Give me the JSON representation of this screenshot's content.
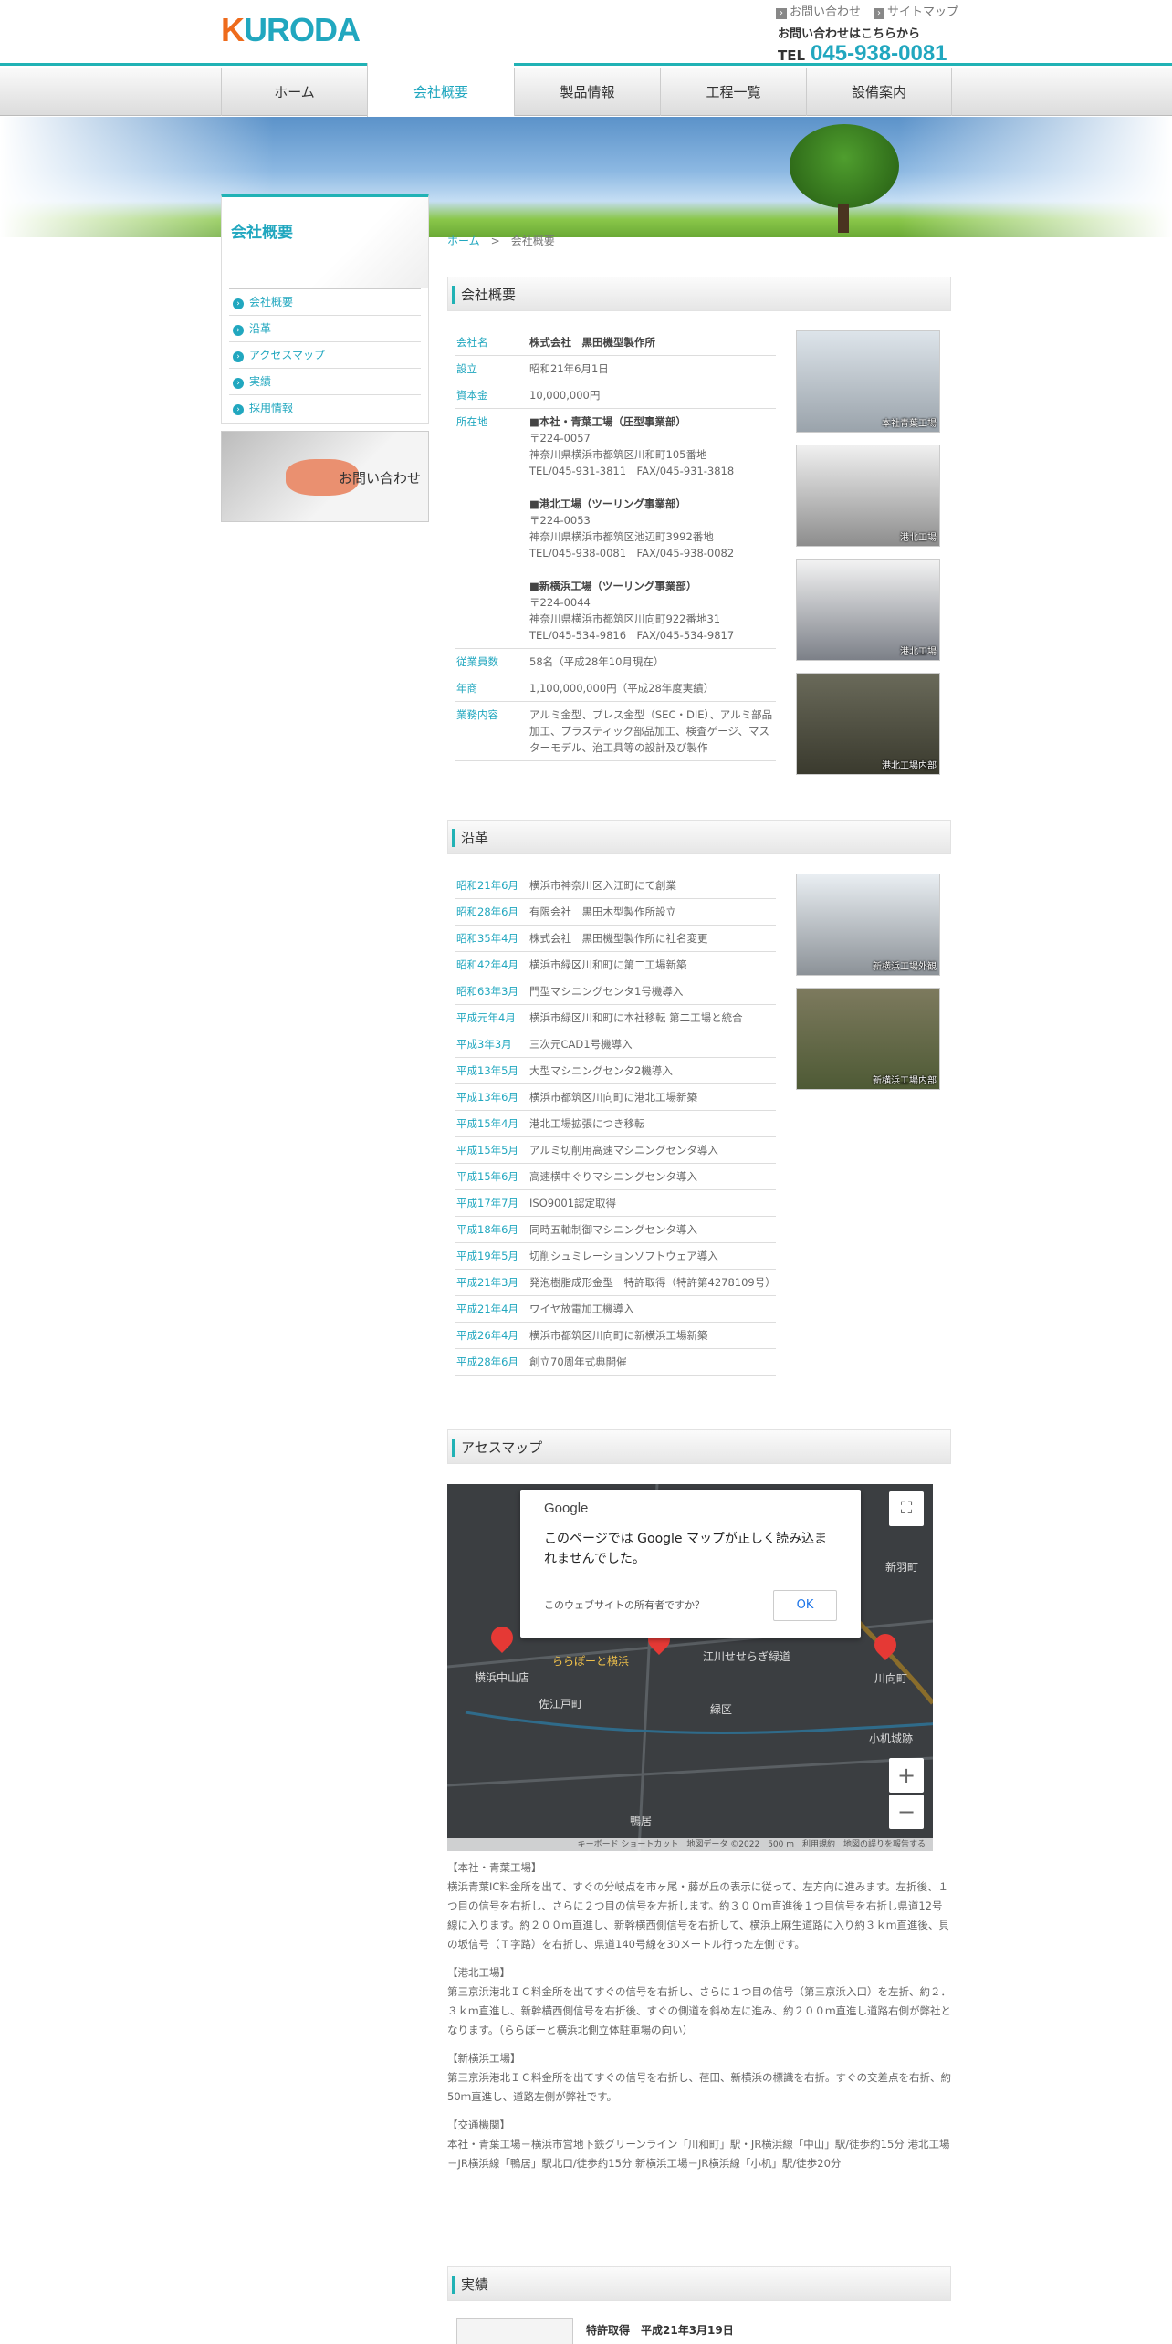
{
  "header": {
    "logo": "KURODA",
    "links": [
      "お問い合わせ",
      "サイトマップ"
    ],
    "tel_label": "お問い合わせはこちらから",
    "tel_prefix": "TEL",
    "tel_number": "045-938-0081"
  },
  "nav": [
    "ホーム",
    "会社概要",
    "製品情報",
    "工程一覧",
    "設備案内"
  ],
  "sidebar": {
    "title": "会社概要",
    "items": [
      "会社概要",
      "沿革",
      "アクセスマップ",
      "実績",
      "採用情報"
    ],
    "contact": "お問い合わせ"
  },
  "breadcrumb": {
    "home": "ホーム",
    "sep": ">",
    "current": "会社概要"
  },
  "overview": {
    "heading": "会社概要",
    "rows": [
      {
        "k": "会社名",
        "v": "株式会社　黒田機型製作所"
      },
      {
        "k": "設立",
        "v": "昭和21年6月1日"
      },
      {
        "k": "資本金",
        "v": "10,000,000円"
      },
      {
        "k": "従業員数",
        "v": "58名（平成28年10月現在）"
      },
      {
        "k": "年商",
        "v": "1,100,000,000円（平成28年度実績）"
      },
      {
        "k": "業務内容",
        "v": "アルミ金型、プレス金型（SEC・DIE）、アルミ部品加工、プラスティック部品加工、検査ゲージ、マスターモデル、治工具等の設計及び製作"
      }
    ],
    "address_key": "所在地",
    "addresses": [
      {
        "name": "■本社・青葉工場（圧型事業部）",
        "zip": "〒224-0057",
        "addr": "神奈川県横浜市都筑区川和町105番地",
        "tel": "TEL/045-931-3811　FAX/045-931-3818"
      },
      {
        "name": "■港北工場（ツーリング事業部）",
        "zip": "〒224-0053",
        "addr": "神奈川県横浜市都筑区池辺町3992番地",
        "tel": "TEL/045-938-0081　FAX/045-938-0082"
      },
      {
        "name": "■新横浜工場（ツーリング事業部）",
        "zip": "〒224-0044",
        "addr": "神奈川県横浜市都筑区川向町922番地31",
        "tel": "TEL/045-534-9816　FAX/045-534-9817"
      }
    ],
    "photos": [
      "本社青葉工場",
      "港北工場",
      "港北工場",
      "港北工場内部"
    ]
  },
  "history": {
    "heading": "沿革",
    "rows": [
      [
        "昭和21年6月",
        "横浜市神奈川区入江町にて創業"
      ],
      [
        "昭和28年6月",
        "有限会社　黒田木型製作所設立"
      ],
      [
        "昭和35年4月",
        "株式会社　黒田機型製作所に社名変更"
      ],
      [
        "昭和42年4月",
        "横浜市緑区川和町に第二工場新築"
      ],
      [
        "昭和63年3月",
        "門型マシニングセンタ1号機導入"
      ],
      [
        "平成元年4月",
        "横浜市緑区川和町に本社移転 第二工場と統合"
      ],
      [
        "平成3年3月",
        "三次元CAD1号機導入"
      ],
      [
        "平成13年5月",
        "大型マシニングセンタ2機導入"
      ],
      [
        "平成13年6月",
        "横浜市都筑区川向町に港北工場新築"
      ],
      [
        "平成15年4月",
        "港北工場拡張につき移転"
      ],
      [
        "平成15年5月",
        "アルミ切削用高速マシニングセンタ導入"
      ],
      [
        "平成15年6月",
        "高速横中ぐりマシニングセンタ導入"
      ],
      [
        "平成17年7月",
        "ISO9001認定取得"
      ],
      [
        "平成18年6月",
        "同時五軸制御マシニングセンタ導入"
      ],
      [
        "平成19年5月",
        "切削シュミレーションソフトウェア導入"
      ],
      [
        "平成21年3月",
        "発泡樹脂成形金型　特許取得（特許第4278109号）"
      ],
      [
        "平成21年4月",
        "ワイヤ放電加工機導入"
      ],
      [
        "平成26年4月",
        "横浜市都筑区川向町に新横浜工場新築"
      ],
      [
        "平成28年6月",
        "創立70周年式典開催"
      ]
    ],
    "photos": [
      "新横浜工場外観",
      "新横浜工場内部"
    ]
  },
  "access": {
    "heading": "アセスマップ",
    "map": {
      "brand": "Google",
      "message": "このページでは Google マップが正しく読み込まれませんでした。",
      "question": "このウェブサイトの所有者ですか？",
      "ok": "OK",
      "footer": "キーボード ショートカット　地図データ ©2022　500 m　利用規約　地図の誤りを報告する",
      "labels": [
        "ららぽーと横浜",
        "横浜中山店",
        "江川せせらぎ緑道",
        "緑区",
        "小机城跡",
        "新羽町",
        "鴨居",
        "佐江戸町",
        "川向町"
      ]
    },
    "texts": [
      [
        "【本社・青葉工場】",
        "横浜青葉IC料金所を出て、すぐの分岐点を市ヶ尾・藤が丘の表示に従って、左方向に進みます。左折後、１つ目の信号を右折し、さらに２つ目の信号を左折します。約３００ｍ直進後１つ目信号を右折し県道12号線に入ります。約２００ｍ直進し、新幹横西側信号を右折して、横浜上麻生道路に入り約３ｋｍ直進後、貝の坂信号（Ｔ字路）を右折し、県道140号線を30メートル行った左側です。"
      ],
      [
        "【港北工場】",
        "第三京浜港北ＩＣ料金所を出てすぐの信号を右折し、さらに１つ目の信号（第三京浜入口）を左折、約２．３ｋｍ直進し、新幹横西側信号を右折後、すぐの側道を斜め左に進み、約２００ｍ直進し道路右側が弊社となります。（ららぽーと横浜北側立体駐車場の向い）"
      ],
      [
        "【新横浜工場】",
        "第三京浜港北ＩＣ料金所を出てすぐの信号を右折し、荏田、新横浜の標識を右折。すぐの交差点を右折、約50ｍ直進し、道路左側が弊社です。"
      ],
      [
        "【交通機関】",
        "本社・青葉工場－横浜市営地下鉄グリーンライン「川和町」駅・JR横浜線「中山」駅/徒歩約15分 港北工場－JR横浜線「鴨居」駅北口/徒歩約15分 新横浜工場－JR横浜線「小机」駅/徒歩20分"
      ]
    ]
  },
  "results": {
    "heading": "実績",
    "item": "特許取得　平成21年3月19日"
  }
}
